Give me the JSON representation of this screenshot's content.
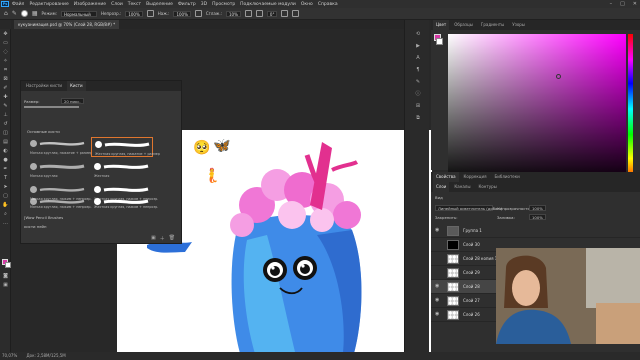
{
  "menubar": {
    "items": [
      "Файл",
      "Редактирование",
      "Изображение",
      "Слои",
      "Текст",
      "Выделение",
      "Фильтр",
      "3D",
      "Просмотр",
      "Подключаемые модули",
      "Окно",
      "Справка"
    ]
  },
  "options": {
    "mode_label": "Режим:",
    "mode_value": "Нормальный",
    "opacity_label": "Непрозр.:",
    "opacity_value": "100%",
    "flow_label": "Наж.:",
    "flow_value": "100%",
    "smooth_label": "Сглаж.:",
    "smooth_value": "10%",
    "angle_value": "0°"
  },
  "document": {
    "tab_label": "кукуанимация.psd @ 70% (Слой 28, RGB/8#) *"
  },
  "brush_panel": {
    "tabs": [
      "Настройки кисти",
      "Кисти"
    ],
    "size_label": "Размер:",
    "size_value": "20 пикс.",
    "group_label": "Основные кисти",
    "brushes": [
      {
        "label": "Мягкая круглая, нажатие + размер"
      },
      {
        "label": "Жесткая круглая, нажатие + размер"
      },
      {
        "label": "Мягкая круглая"
      },
      {
        "label": "Жесткая"
      },
      {
        "label": "Мягкая круглая, нажим + непрозр."
      },
      {
        "label": "Жесткая круглая, нажим + непрозр."
      },
      {
        "label": "Мягкая круглая, нажим + непрозр."
      },
      {
        "label": "Жесткая круглая, нажим + непрозр."
      }
    ],
    "folders": [
      "[Wow Pencil Brushes",
      "кисти пейн"
    ]
  },
  "color_panel": {
    "tabs": [
      "Цвет",
      "Образцы",
      "Градиенты",
      "Узоры"
    ],
    "hue": "#ff00ff"
  },
  "layers_panel": {
    "tabs": [
      "Свойства",
      "Коррекция",
      "Библиотеки"
    ],
    "tabs2": [
      "Слои",
      "Каналы",
      "Контуры"
    ],
    "kind_label": "Вид",
    "blend_value": "Линейный осветлитель (добав.)",
    "opacity_label": "Непрозрачность:",
    "opacity_value": "100%",
    "lock_label": "Закрепить:",
    "fill_label": "Заливка:",
    "fill_value": "100%",
    "layers": [
      {
        "name": "Группа 1",
        "type": "group"
      },
      {
        "name": "Слой 30",
        "type": "black"
      },
      {
        "name": "Слой 28 копия 1",
        "type": "normal"
      },
      {
        "name": "Слой 29",
        "type": "normal"
      },
      {
        "name": "Слой 28",
        "type": "normal",
        "selected": true
      },
      {
        "name": "Слой 27",
        "type": "normal"
      },
      {
        "name": "Слой 26",
        "type": "normal"
      }
    ]
  },
  "statusbar": {
    "zoom": "70,07%",
    "info": "Док: 2,58М/125,5М"
  }
}
